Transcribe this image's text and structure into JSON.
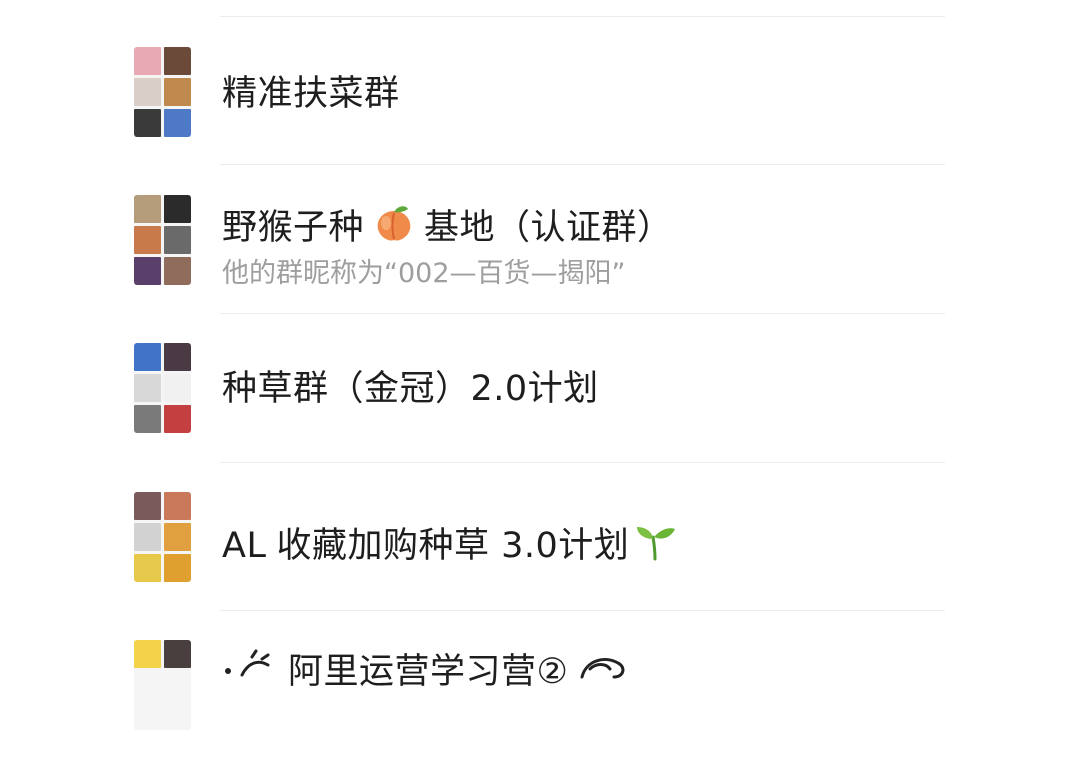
{
  "groups": [
    {
      "name": "精准扶菜群",
      "tiles": [
        "#e8a9b4",
        "#6b4a3a",
        "#d9cfc8",
        "#c08a4e",
        "#3a3a3a",
        "#4d79c6"
      ]
    },
    {
      "name_part1": "野猴子种",
      "name_icon": "peach-icon",
      "name_part2": "基地（认证群）",
      "subtitle": "他的群昵称为“002—百货—揭阳”",
      "tiles": [
        "#b59c7a",
        "#2b2b2b",
        "#c97a4a",
        "#6a6a6a",
        "#5a3f6b",
        "#8f6c5c"
      ]
    },
    {
      "name": "种草群（金冠）2.0计划",
      "tiles": [
        "#3f74c9",
        "#4a3a44",
        "#d8d8d8",
        "#f1f1f1",
        "#7a7a7a",
        "#c44040"
      ]
    },
    {
      "name_part1": "AL",
      "name_part2": "收藏加购种草 3.0计划",
      "name_icon": "sprout-icon",
      "tiles": [
        "#7a5a5a",
        "#c9785a",
        "#d2d2d2",
        "#e0a040",
        "#e6c84a",
        "#e0a030"
      ]
    },
    {
      "name_fragment": "阿里运营学习营②",
      "tiles": [
        "#f2d34a",
        "#4a3f3f"
      ]
    }
  ],
  "colors": {
    "title": "#1e1e1e",
    "subtitle": "#9e9e9e",
    "divider": "#ececec",
    "background": "#ffffff"
  }
}
